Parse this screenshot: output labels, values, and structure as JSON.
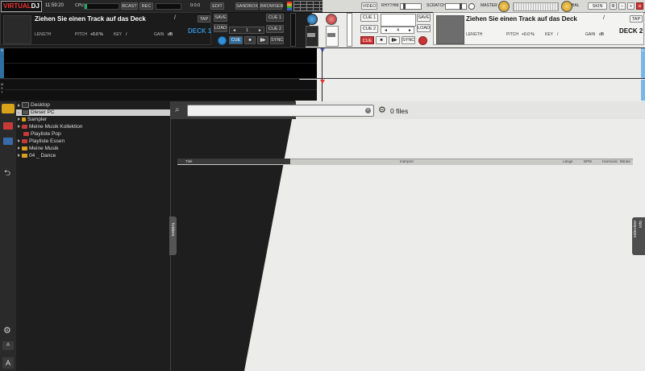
{
  "app": {
    "logo_left": "VIRTUAL",
    "logo_right": "DJ"
  },
  "topbar": {
    "time": "11:59:20",
    "cpu_label": "CPU",
    "rec_label": "REC",
    "bcast_label": "BCAST",
    "counter": "0:0.0",
    "edit_label": "EDIT",
    "sandbox_label": "SANDBOX",
    "browser_label": "BROWSER",
    "video_label": "VIDEO",
    "rhythm_label": "RHYTHM",
    "scratch_label": "SCRATCH",
    "master_label": "MASTER",
    "bal_label": "BAL",
    "skin_label": "SKIN"
  },
  "deck1": {
    "title": "Ziehen Sie einen Track auf das Deck",
    "slash": "/",
    "tap": "TAP",
    "length_label": "LENGTH",
    "pitch_label": "PITCH",
    "pitch_value": "+0.0 %",
    "key_label": "KEY",
    "key_value": "/",
    "gain_label": "GAIN",
    "gain_unit": "dB",
    "deck_name": "DECK 1",
    "save": "SAVE",
    "load": "LOAD",
    "cue1": "CUE 1",
    "cue2": "CUE 2",
    "loop_value": "1",
    "cue": "CUE",
    "sync": "SYNC"
  },
  "deck2": {
    "title": "Ziehen Sie einen Track auf das Deck",
    "slash": "/",
    "tap": "TAP",
    "length_label": "LENGTH",
    "pitch_label": "PITCH",
    "pitch_value": "+0.0 %",
    "key_label": "KEY",
    "key_value": "/",
    "gain_label": "GAIN",
    "gain_unit": "dB",
    "deck_name": "DECK 2",
    "save": "SAVE",
    "load": "LOAD",
    "cue1": "CUE 1",
    "cue2": "CUE 2",
    "loop_value": "4",
    "cue": "CUE",
    "sync": "SYNC"
  },
  "browser": {
    "tree": [
      {
        "label": "Desktop",
        "icon": "monitor-icon",
        "selected": false
      },
      {
        "label": "Dieser PC",
        "icon": "computer-icon",
        "selected": true
      },
      {
        "label": "Sampler",
        "icon": "sampler-icon",
        "selected": false
      },
      {
        "label": "Meine Musik Kollektion",
        "icon": "collection-icon",
        "selected": false
      },
      {
        "label": "Playliste Pop",
        "icon": "playlist-icon",
        "selected": false
      },
      {
        "label": "Playliste Essen",
        "icon": "playlist-icon",
        "selected": false
      },
      {
        "label": "Meine Musik",
        "icon": "folder-icon",
        "selected": false
      },
      {
        "label": "04 _ Dance",
        "icon": "folder-icon",
        "selected": false
      }
    ],
    "search_placeholder": "",
    "files_count": "0 files",
    "columns": [
      "Titel",
      "Interpret",
      "Länge",
      "BPM",
      "Harmonic",
      "Bitrate"
    ],
    "folders_tab": "folders",
    "sideview_tab": "sideview",
    "sideview_info": "info",
    "font_small": "A",
    "font_large": "A"
  },
  "colors": {
    "accent": "#2f8fd8",
    "cue_red": "#cc3333",
    "folder_yellow": "#d9a21b",
    "playlist_red": "#c83a3a"
  }
}
